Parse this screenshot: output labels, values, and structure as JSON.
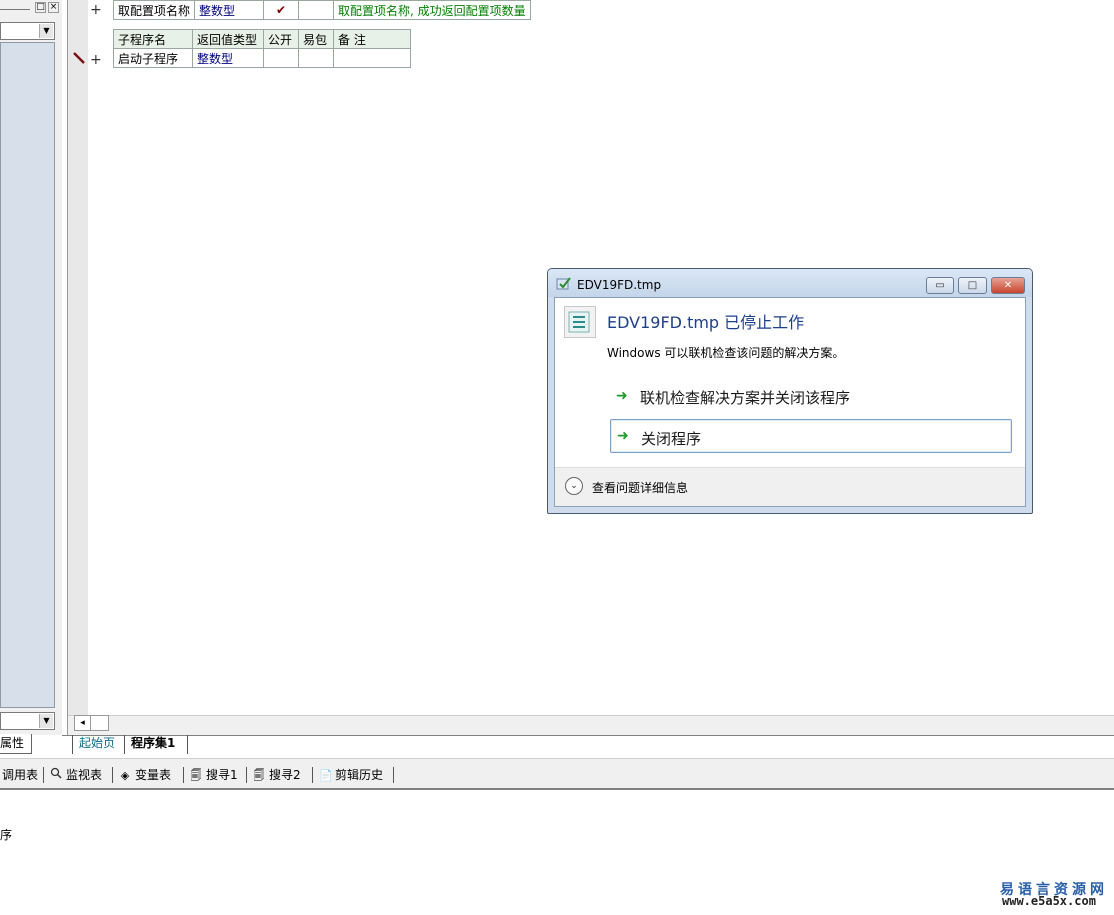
{
  "left_panel": {
    "properties_tab": "属性",
    "mini_buttons": [
      "□",
      "×"
    ],
    "combo_arrow": "▼"
  },
  "editor": {
    "row1": {
      "name": "取配置项名称",
      "return_type": "整数型",
      "public_mark": "✔",
      "comment": "取配置项名称, 成功返回配置项数量"
    },
    "sub_table": {
      "headers": [
        "子程序名",
        "返回值类型",
        "公开",
        "易包",
        "备 注"
      ],
      "row": {
        "name": "启动子程序",
        "return_type": "整数型"
      }
    },
    "plus_sign": "+"
  },
  "doc_tabs": {
    "home": "起始页",
    "program_set": "程序集1"
  },
  "toolbar": {
    "items": [
      {
        "icon": "call-table-icon",
        "label": "调用表"
      },
      {
        "icon": "magnifier-icon",
        "label": "监视表",
        "glyph": "🔍"
      },
      {
        "icon": "variable-icon",
        "label": "变量表",
        "glyph": "◈"
      },
      {
        "icon": "search-doc-icon",
        "label": "搜寻1",
        "glyph": "🗐"
      },
      {
        "icon": "search-doc-icon",
        "label": "搜寻2",
        "glyph": "🗐"
      },
      {
        "icon": "clipboard-icon",
        "label": "剪辑历史",
        "glyph": "📄"
      }
    ]
  },
  "output": {
    "text": "序"
  },
  "watermark": {
    "line1": "易语言资源网",
    "line2": "www.e5a5x.com"
  },
  "dialog": {
    "title": "EDV19FD.tmp",
    "heading": "EDV19FD.tmp 已停止工作",
    "description": "Windows 可以联机检查该问题的解决方案。",
    "option1": "联机检查解决方案并关闭该程序",
    "option2": "关闭程序",
    "details": "查看问题详细信息",
    "win_buttons": {
      "min": "▭",
      "max": "□",
      "close": "✕"
    },
    "colors": {
      "heading": "#1e3f8a",
      "arrow": "#1e9b2a"
    }
  }
}
